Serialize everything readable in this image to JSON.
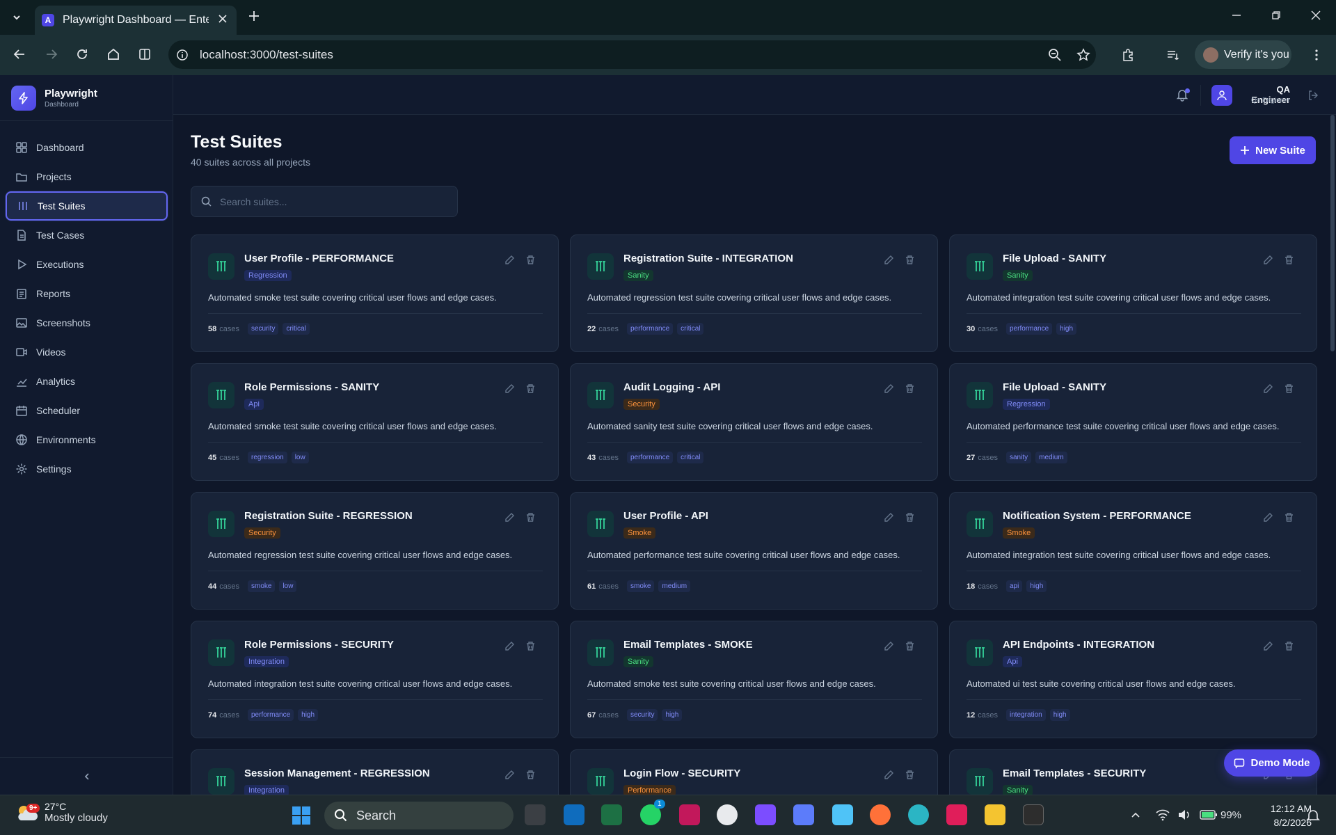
{
  "browser": {
    "tab_title": "Playwright Dashboard — Enterp",
    "url": "localhost:3000/test-suites",
    "verify_label": "Verify it's you"
  },
  "brand": {
    "name": "Playwright",
    "sub": "Dashboard"
  },
  "nav": [
    {
      "label": "Dashboard",
      "icon": "grid-icon",
      "active": false
    },
    {
      "label": "Projects",
      "icon": "folder-icon",
      "active": false
    },
    {
      "label": "Test Suites",
      "icon": "columns-icon",
      "active": true
    },
    {
      "label": "Test Cases",
      "icon": "file-icon",
      "active": false
    },
    {
      "label": "Executions",
      "icon": "play-icon",
      "active": false
    },
    {
      "label": "Reports",
      "icon": "clipboard-icon",
      "active": false
    },
    {
      "label": "Screenshots",
      "icon": "image-icon",
      "active": false
    },
    {
      "label": "Videos",
      "icon": "video-icon",
      "active": false
    },
    {
      "label": "Analytics",
      "icon": "chart-icon",
      "active": false
    },
    {
      "label": "Scheduler",
      "icon": "calendar-icon",
      "active": false
    },
    {
      "label": "Environments",
      "icon": "globe-icon",
      "active": false
    },
    {
      "label": "Settings",
      "icon": "gear-icon",
      "active": false
    }
  ],
  "user": {
    "name": "QA Engineer",
    "role": "Qa Engineer"
  },
  "page": {
    "title": "Test Suites",
    "subtitle": "40 suites across all projects",
    "new_button": "New Suite",
    "search_placeholder": "Search suites..."
  },
  "suites": [
    {
      "title": "User Profile - PERFORMANCE",
      "category": "Regression",
      "cat_color": "blue",
      "description": "Automated smoke test suite covering critical user flows and edge cases.",
      "cases": "58",
      "tags": [
        "security",
        "critical"
      ]
    },
    {
      "title": "Registration Suite - INTEGRATION",
      "category": "Sanity",
      "cat_color": "green",
      "description": "Automated regression test suite covering critical user flows and edge cases.",
      "cases": "22",
      "tags": [
        "performance",
        "critical"
      ]
    },
    {
      "title": "File Upload - SANITY",
      "category": "Sanity",
      "cat_color": "green",
      "description": "Automated integration test suite covering critical user flows and edge cases.",
      "cases": "30",
      "tags": [
        "performance",
        "high"
      ]
    },
    {
      "title": "Role Permissions - SANITY",
      "category": "Api",
      "cat_color": "blue",
      "description": "Automated smoke test suite covering critical user flows and edge cases.",
      "cases": "45",
      "tags": [
        "regression",
        "low"
      ]
    },
    {
      "title": "Audit Logging - API",
      "category": "Security",
      "cat_color": "orange",
      "description": "Automated sanity test suite covering critical user flows and edge cases.",
      "cases": "43",
      "tags": [
        "performance",
        "critical"
      ]
    },
    {
      "title": "File Upload - SANITY",
      "category": "Regression",
      "cat_color": "blue",
      "description": "Automated performance test suite covering critical user flows and edge cases.",
      "cases": "27",
      "tags": [
        "sanity",
        "medium"
      ]
    },
    {
      "title": "Registration Suite - REGRESSION",
      "category": "Security",
      "cat_color": "orange",
      "description": "Automated regression test suite covering critical user flows and edge cases.",
      "cases": "44",
      "tags": [
        "smoke",
        "low"
      ]
    },
    {
      "title": "User Profile - API",
      "category": "Smoke",
      "cat_color": "orange",
      "description": "Automated performance test suite covering critical user flows and edge cases.",
      "cases": "61",
      "tags": [
        "smoke",
        "medium"
      ]
    },
    {
      "title": "Notification System - PERFORMANCE",
      "category": "Smoke",
      "cat_color": "orange",
      "description": "Automated integration test suite covering critical user flows and edge cases.",
      "cases": "18",
      "tags": [
        "api",
        "high"
      ]
    },
    {
      "title": "Role Permissions - SECURITY",
      "category": "Integration",
      "cat_color": "blue",
      "description": "Automated integration test suite covering critical user flows and edge cases.",
      "cases": "74",
      "tags": [
        "performance",
        "high"
      ]
    },
    {
      "title": "Email Templates - SMOKE",
      "category": "Sanity",
      "cat_color": "green",
      "description": "Automated smoke test suite covering critical user flows and edge cases.",
      "cases": "67",
      "tags": [
        "security",
        "high"
      ]
    },
    {
      "title": "API Endpoints - INTEGRATION",
      "category": "Api",
      "cat_color": "blue",
      "description": "Automated ui test suite covering critical user flows and edge cases.",
      "cases": "12",
      "tags": [
        "integration",
        "high"
      ]
    },
    {
      "title": "Session Management - REGRESSION",
      "category": "Integration",
      "cat_color": "blue",
      "description": "",
      "cases": "",
      "tags": []
    },
    {
      "title": "Login Flow - SECURITY",
      "category": "Performance",
      "cat_color": "orange",
      "description": "",
      "cases": "",
      "tags": []
    },
    {
      "title": "Email Templates - SECURITY",
      "category": "Sanity",
      "cat_color": "green",
      "description": "",
      "cases": "",
      "tags": []
    }
  ],
  "cases_label": "cases",
  "demo_mode": "Demo Mode",
  "taskbar": {
    "weather_badge": "9+",
    "temp": "27°C",
    "condition": "Mostly cloudy",
    "search": "Search",
    "whatsapp_badge": "1",
    "battery": "99%",
    "time": "12:12 AM",
    "date": "8/2/2026"
  }
}
